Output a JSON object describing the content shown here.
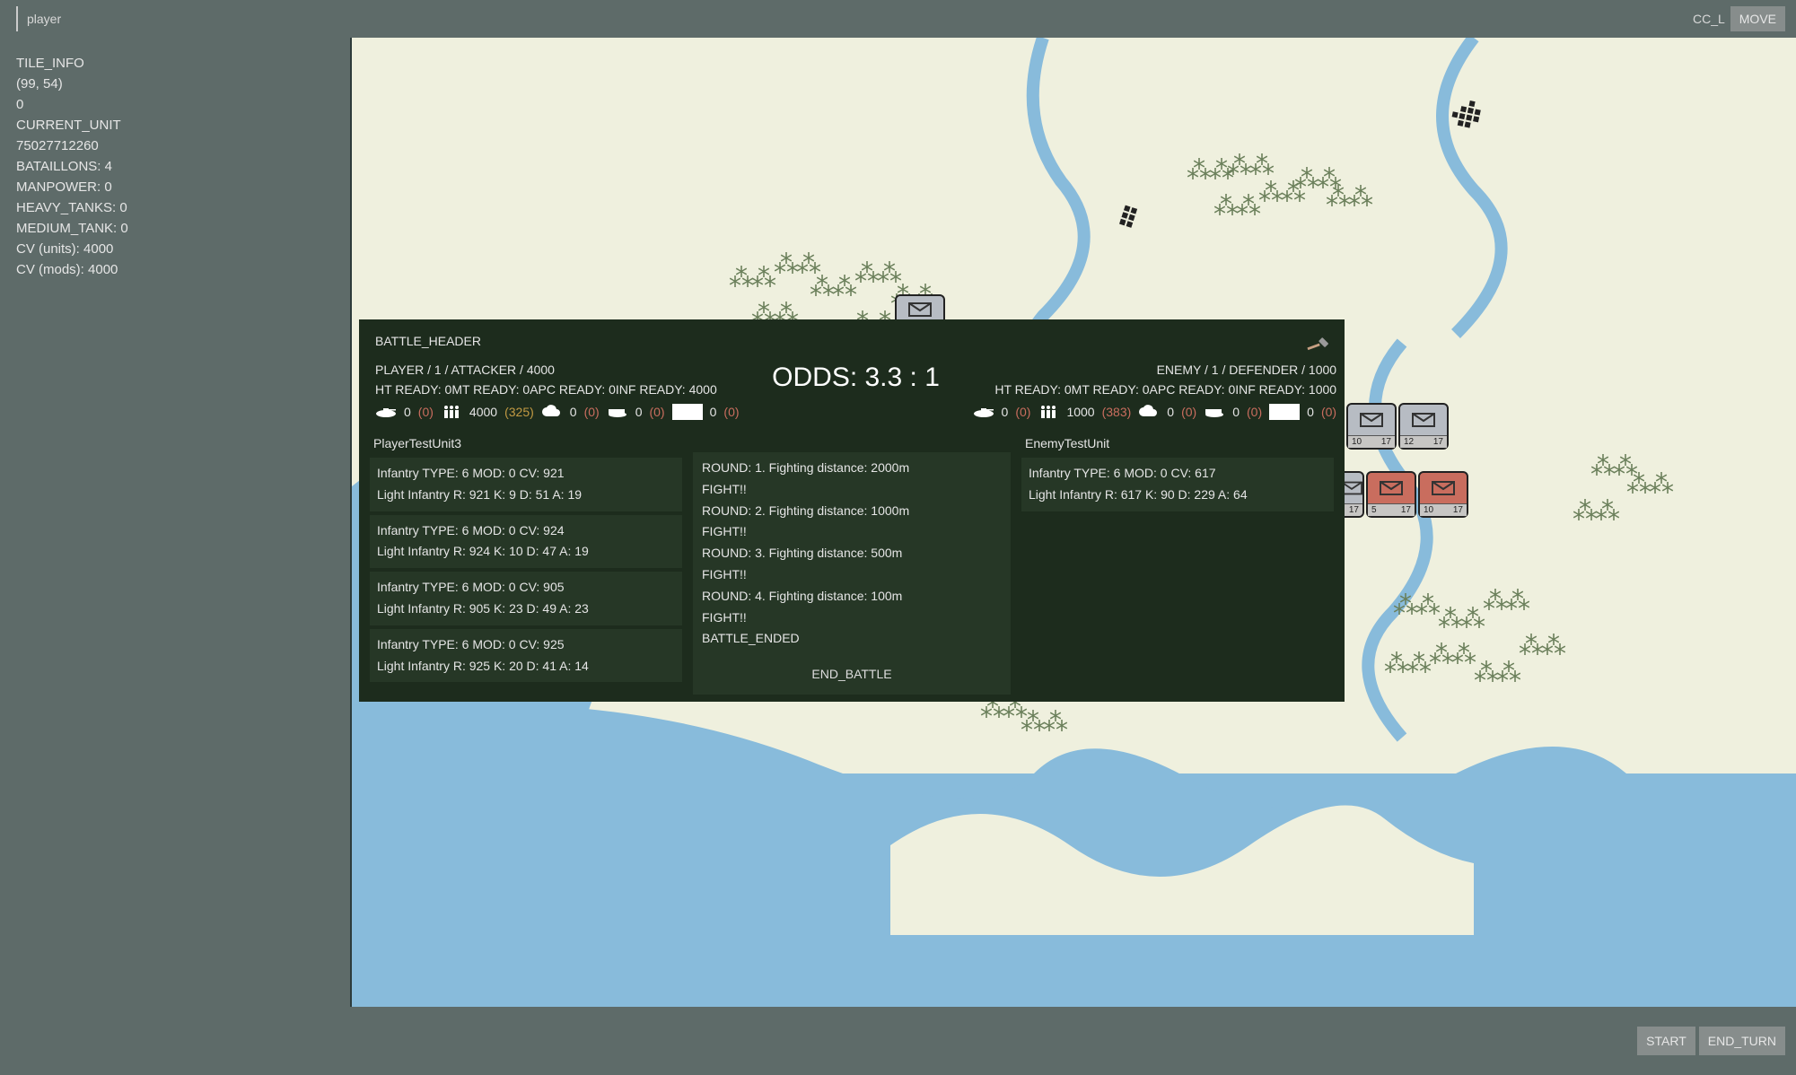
{
  "topbar": {
    "player_label": "player",
    "cc_label": "CC_L",
    "move_label": "MOVE"
  },
  "sidebar": {
    "tile_info": "TILE_INFO",
    "coords": "(99, 54)",
    "zero": "0",
    "current_unit": "CURRENT_UNIT",
    "unit_id": "75027712260",
    "bataillons": "BATAILLONS: 4",
    "manpower": "MANPOWER: 0",
    "heavy_tanks": "HEAVY_TANKS: 0",
    "medium_tank": "MEDIUM_TANK: 0",
    "cv_units": "CV (units): 4000",
    "cv_mods": "CV (mods): 4000"
  },
  "bottombar": {
    "start": "START",
    "end_turn": "END_TURN"
  },
  "battle": {
    "header": "BATTLE_HEADER",
    "odds": "ODDS: 3.3 : 1",
    "player_side": {
      "title": "PLAYER / 1 / ATTACKER / 4000",
      "ready": "HT READY: 0MT READY: 0APC READY: 0INF READY: 4000",
      "stats": {
        "tank": "0",
        "tank_delta": "(0)",
        "inf": "4000",
        "inf_delta": "(325)",
        "cloud": "0",
        "cloud_delta": "(0)",
        "apc": "0",
        "apc_delta": "(0)",
        "box_val": "0",
        "box_delta": "(0)"
      }
    },
    "enemy_side": {
      "title": "ENEMY / 1 / DEFENDER / 1000",
      "ready": "HT READY: 0MT READY: 0APC READY: 0INF READY: 1000",
      "stats": {
        "tank": "0",
        "tank_delta": "(0)",
        "inf": "1000",
        "inf_delta": "(383)",
        "cloud": "0",
        "cloud_delta": "(0)",
        "apc": "0",
        "apc_delta": "(0)",
        "box_val": "0",
        "box_delta": "(0)"
      }
    },
    "player_unit_title": "PlayerTestUnit3",
    "player_units": [
      {
        "line1": "Infantry TYPE: 6 MOD: 0 CV: 921",
        "line2": "Light Infantry R: 921 K: 9 D: 51 A: 19"
      },
      {
        "line1": "Infantry TYPE: 6 MOD: 0 CV: 924",
        "line2": "Light Infantry R: 924 K: 10 D: 47 A: 19"
      },
      {
        "line1": "Infantry TYPE: 6 MOD: 0 CV: 905",
        "line2": "Light Infantry R: 905 K: 23 D: 49 A: 23"
      },
      {
        "line1": "Infantry TYPE: 6 MOD: 0 CV: 925",
        "line2": "Light Infantry R: 925 K: 20 D: 41 A: 14"
      }
    ],
    "enemy_unit_title": "EnemyTestUnit",
    "enemy_units": [
      {
        "line1": "Infantry TYPE: 6 MOD: 0 CV: 617",
        "line2": "Light Infantry R: 617 K: 90 D: 229 A: 64"
      }
    ],
    "log": [
      "ROUND: 1. Fighting distance: 2000m",
      "FIGHT!!",
      "ROUND: 2. Fighting distance: 1000m",
      "FIGHT!!",
      "ROUND: 3. Fighting distance: 500m",
      "FIGHT!!",
      "ROUND: 4. Fighting distance: 100m",
      "FIGHT!!",
      "BATTLE_ENDED"
    ],
    "end_battle": "END_BATTLE"
  },
  "counters": [
    {
      "left": "10",
      "right": "17",
      "red": false
    },
    {
      "left": "12",
      "right": "17",
      "red": false
    },
    {
      "left": "",
      "right": "17",
      "red": false,
      "half": true
    },
    {
      "left": "5",
      "right": "17",
      "red": true
    },
    {
      "left": "10",
      "right": "17",
      "red": true
    }
  ]
}
